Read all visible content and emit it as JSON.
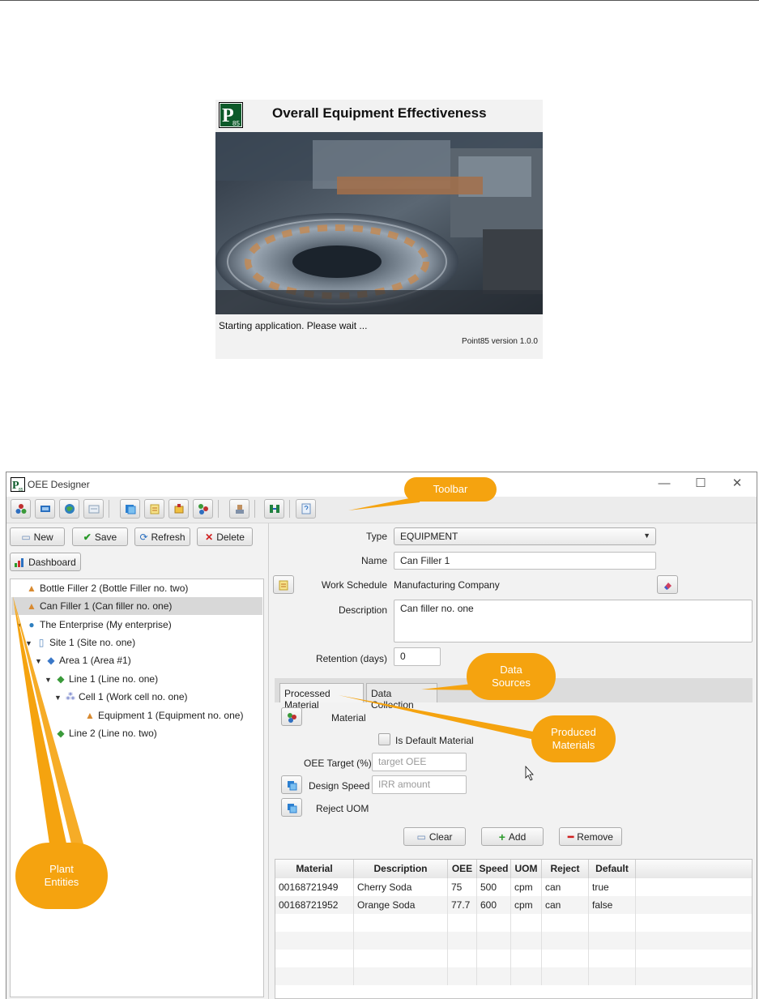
{
  "splash": {
    "logo_text": "P",
    "logo_sub": "85",
    "title": "Overall Equipment Effectiveness",
    "status": "Starting application.  Please wait ...",
    "version": "Point85 version 1.0.0"
  },
  "window": {
    "title": "OEE Designer",
    "controls": {
      "minimize": "—",
      "maximize": "☐",
      "close": "✕"
    }
  },
  "toolbar": {
    "icons": [
      "uom-icon",
      "materials-icon",
      "reason-icon",
      "calendar-icon",
      "import-icon",
      "work-schedule-icon",
      "tester-icon",
      "collector-icon",
      "server-icon",
      "dashboard-icon",
      "help-icon"
    ]
  },
  "left": {
    "buttons": {
      "new": "New",
      "save": "Save",
      "refresh": "Refresh",
      "delete": "Delete",
      "dashboard": "Dashboard"
    },
    "tree": [
      {
        "label": "Bottle Filler 2 (Bottle Filler no. two)",
        "icon": "equipment"
      },
      {
        "label": "Can Filler 1 (Can filler no. one)",
        "icon": "equipment"
      },
      {
        "label": "The Enterprise (My enterprise)",
        "icon": "enterprise"
      },
      {
        "label": "Site 1 (Site no. one)",
        "icon": "site"
      },
      {
        "label": "Area 1 (Area #1)",
        "icon": "area"
      },
      {
        "label": "Line 1 (Line no. one)",
        "icon": "line"
      },
      {
        "label": "Cell 1 (Work cell no. one)",
        "icon": "cell"
      },
      {
        "label": "Equipment 1 (Equipment no. one)",
        "icon": "equipment"
      },
      {
        "label": "Line 2 (Line no. two)",
        "icon": "line"
      }
    ]
  },
  "form": {
    "type_label": "Type",
    "type_value": "EQUIPMENT",
    "name_label": "Name",
    "name_value": "Can Filler 1",
    "schedule_label": "Work Schedule",
    "schedule_value": "Manufacturing Company",
    "description_label": "Description",
    "description_value": "Can filler no. one",
    "retention_label": "Retention (days)",
    "retention_value": "0"
  },
  "tabs": {
    "processed": "Processed Material",
    "collection": "Data Collection"
  },
  "material": {
    "material_label": "Material",
    "default_label": "Is Default Material",
    "oee_label": "OEE Target (%)",
    "oee_placeholder": "target OEE",
    "speed_label": "Design Speed",
    "speed_placeholder": "IRR amount",
    "reject_label": "Reject UOM",
    "clear": "Clear",
    "add": "Add",
    "remove": "Remove"
  },
  "table": {
    "headers": [
      "Material",
      "Description",
      "OEE",
      "Speed",
      "UOM",
      "Reject",
      "Default"
    ],
    "rows": [
      [
        "00168721949",
        "Cherry Soda",
        "75",
        "500",
        "cpm",
        "can",
        "true"
      ],
      [
        "00168721952",
        "Orange Soda",
        "77.7",
        "600",
        "cpm",
        "can",
        "false"
      ]
    ]
  },
  "callouts": {
    "toolbar": "Toolbar",
    "data_sources": [
      "Data",
      "Sources"
    ],
    "produced": [
      "Produced",
      "Materials"
    ],
    "plant": [
      "Plant",
      "Entities"
    ]
  },
  "colors": {
    "callout": "#f5a30f",
    "selection": "#d8d8d8"
  }
}
